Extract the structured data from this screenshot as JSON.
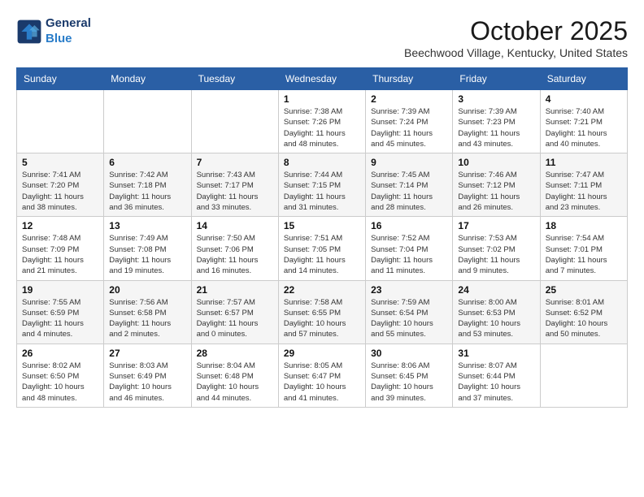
{
  "header": {
    "logo_line1": "General",
    "logo_line2": "Blue",
    "month": "October 2025",
    "location": "Beechwood Village, Kentucky, United States"
  },
  "weekdays": [
    "Sunday",
    "Monday",
    "Tuesday",
    "Wednesday",
    "Thursday",
    "Friday",
    "Saturday"
  ],
  "weeks": [
    [
      {
        "day": "",
        "info": ""
      },
      {
        "day": "",
        "info": ""
      },
      {
        "day": "",
        "info": ""
      },
      {
        "day": "1",
        "info": "Sunrise: 7:38 AM\nSunset: 7:26 PM\nDaylight: 11 hours\nand 48 minutes."
      },
      {
        "day": "2",
        "info": "Sunrise: 7:39 AM\nSunset: 7:24 PM\nDaylight: 11 hours\nand 45 minutes."
      },
      {
        "day": "3",
        "info": "Sunrise: 7:39 AM\nSunset: 7:23 PM\nDaylight: 11 hours\nand 43 minutes."
      },
      {
        "day": "4",
        "info": "Sunrise: 7:40 AM\nSunset: 7:21 PM\nDaylight: 11 hours\nand 40 minutes."
      }
    ],
    [
      {
        "day": "5",
        "info": "Sunrise: 7:41 AM\nSunset: 7:20 PM\nDaylight: 11 hours\nand 38 minutes."
      },
      {
        "day": "6",
        "info": "Sunrise: 7:42 AM\nSunset: 7:18 PM\nDaylight: 11 hours\nand 36 minutes."
      },
      {
        "day": "7",
        "info": "Sunrise: 7:43 AM\nSunset: 7:17 PM\nDaylight: 11 hours\nand 33 minutes."
      },
      {
        "day": "8",
        "info": "Sunrise: 7:44 AM\nSunset: 7:15 PM\nDaylight: 11 hours\nand 31 minutes."
      },
      {
        "day": "9",
        "info": "Sunrise: 7:45 AM\nSunset: 7:14 PM\nDaylight: 11 hours\nand 28 minutes."
      },
      {
        "day": "10",
        "info": "Sunrise: 7:46 AM\nSunset: 7:12 PM\nDaylight: 11 hours\nand 26 minutes."
      },
      {
        "day": "11",
        "info": "Sunrise: 7:47 AM\nSunset: 7:11 PM\nDaylight: 11 hours\nand 23 minutes."
      }
    ],
    [
      {
        "day": "12",
        "info": "Sunrise: 7:48 AM\nSunset: 7:09 PM\nDaylight: 11 hours\nand 21 minutes."
      },
      {
        "day": "13",
        "info": "Sunrise: 7:49 AM\nSunset: 7:08 PM\nDaylight: 11 hours\nand 19 minutes."
      },
      {
        "day": "14",
        "info": "Sunrise: 7:50 AM\nSunset: 7:06 PM\nDaylight: 11 hours\nand 16 minutes."
      },
      {
        "day": "15",
        "info": "Sunrise: 7:51 AM\nSunset: 7:05 PM\nDaylight: 11 hours\nand 14 minutes."
      },
      {
        "day": "16",
        "info": "Sunrise: 7:52 AM\nSunset: 7:04 PM\nDaylight: 11 hours\nand 11 minutes."
      },
      {
        "day": "17",
        "info": "Sunrise: 7:53 AM\nSunset: 7:02 PM\nDaylight: 11 hours\nand 9 minutes."
      },
      {
        "day": "18",
        "info": "Sunrise: 7:54 AM\nSunset: 7:01 PM\nDaylight: 11 hours\nand 7 minutes."
      }
    ],
    [
      {
        "day": "19",
        "info": "Sunrise: 7:55 AM\nSunset: 6:59 PM\nDaylight: 11 hours\nand 4 minutes."
      },
      {
        "day": "20",
        "info": "Sunrise: 7:56 AM\nSunset: 6:58 PM\nDaylight: 11 hours\nand 2 minutes."
      },
      {
        "day": "21",
        "info": "Sunrise: 7:57 AM\nSunset: 6:57 PM\nDaylight: 11 hours\nand 0 minutes."
      },
      {
        "day": "22",
        "info": "Sunrise: 7:58 AM\nSunset: 6:55 PM\nDaylight: 10 hours\nand 57 minutes."
      },
      {
        "day": "23",
        "info": "Sunrise: 7:59 AM\nSunset: 6:54 PM\nDaylight: 10 hours\nand 55 minutes."
      },
      {
        "day": "24",
        "info": "Sunrise: 8:00 AM\nSunset: 6:53 PM\nDaylight: 10 hours\nand 53 minutes."
      },
      {
        "day": "25",
        "info": "Sunrise: 8:01 AM\nSunset: 6:52 PM\nDaylight: 10 hours\nand 50 minutes."
      }
    ],
    [
      {
        "day": "26",
        "info": "Sunrise: 8:02 AM\nSunset: 6:50 PM\nDaylight: 10 hours\nand 48 minutes."
      },
      {
        "day": "27",
        "info": "Sunrise: 8:03 AM\nSunset: 6:49 PM\nDaylight: 10 hours\nand 46 minutes."
      },
      {
        "day": "28",
        "info": "Sunrise: 8:04 AM\nSunset: 6:48 PM\nDaylight: 10 hours\nand 44 minutes."
      },
      {
        "day": "29",
        "info": "Sunrise: 8:05 AM\nSunset: 6:47 PM\nDaylight: 10 hours\nand 41 minutes."
      },
      {
        "day": "30",
        "info": "Sunrise: 8:06 AM\nSunset: 6:45 PM\nDaylight: 10 hours\nand 39 minutes."
      },
      {
        "day": "31",
        "info": "Sunrise: 8:07 AM\nSunset: 6:44 PM\nDaylight: 10 hours\nand 37 minutes."
      },
      {
        "day": "",
        "info": ""
      }
    ]
  ]
}
